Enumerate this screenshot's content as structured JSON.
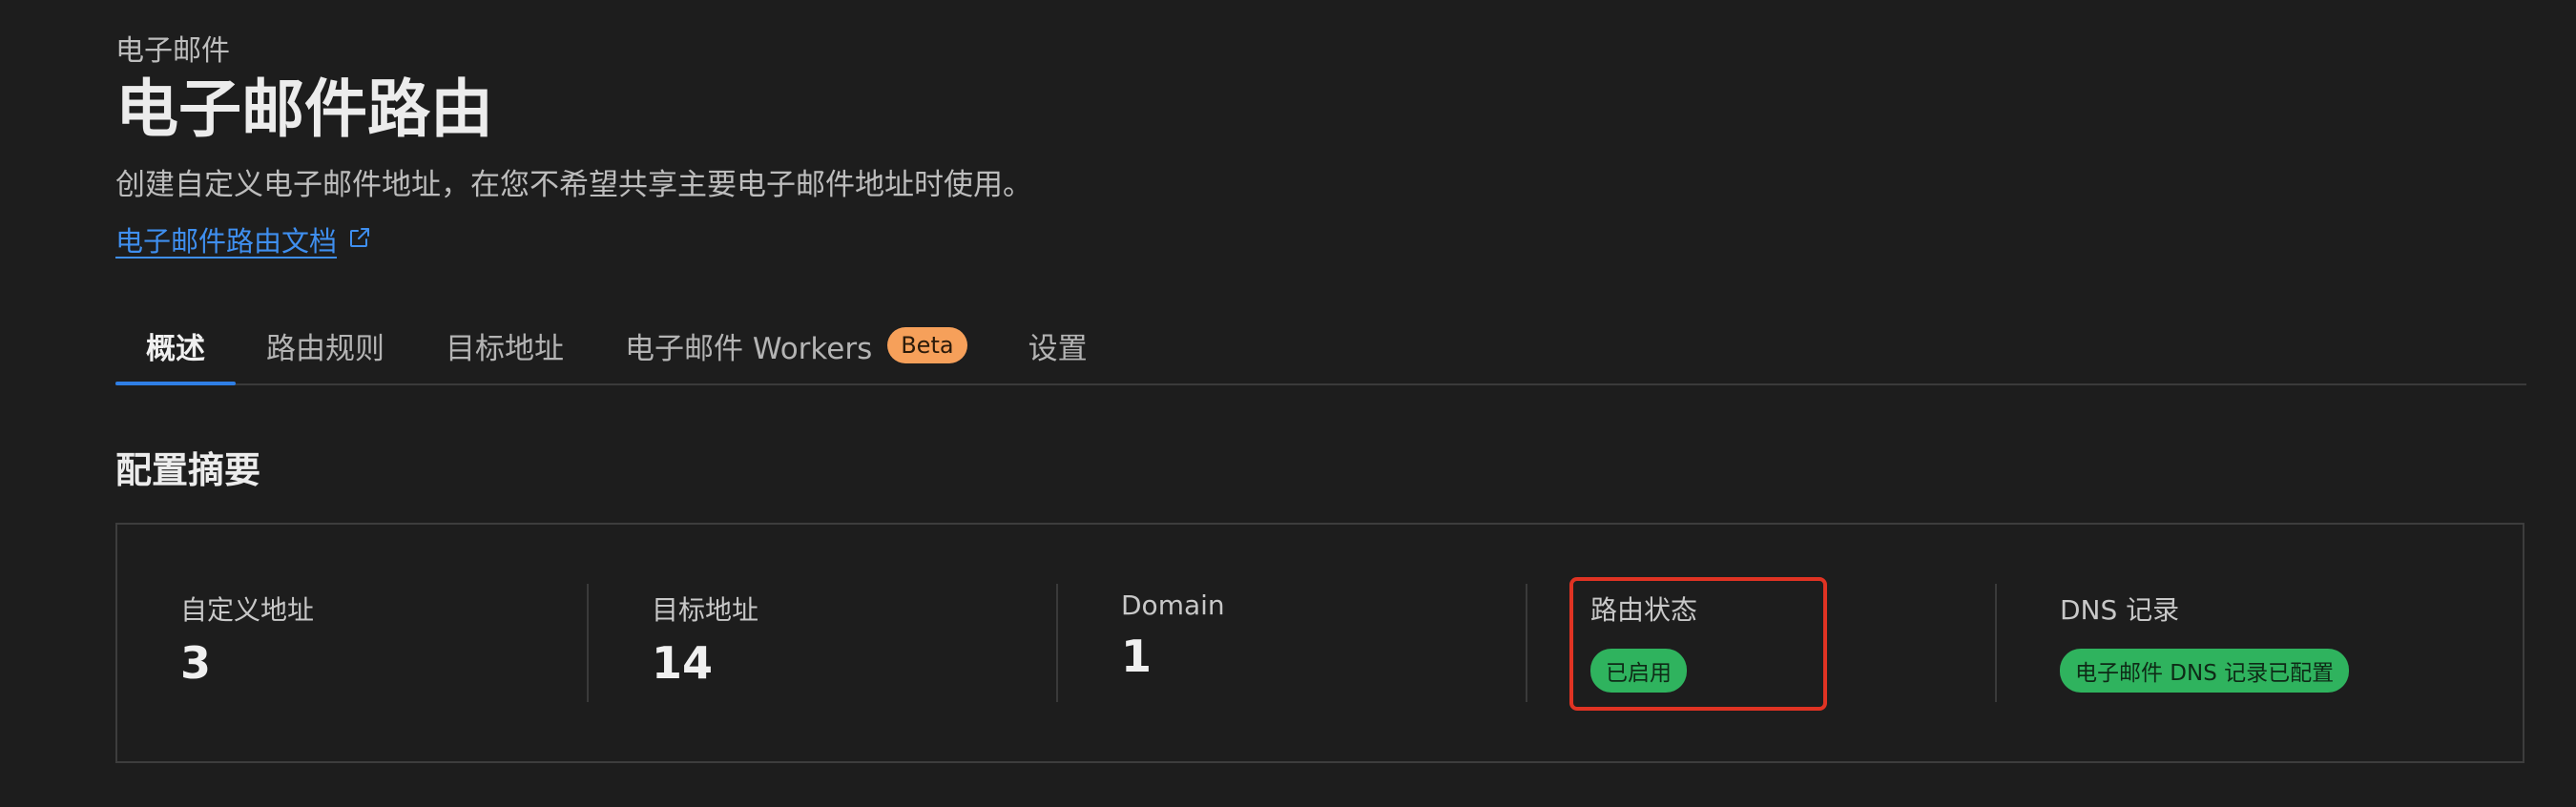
{
  "header": {
    "eyebrow": "电子邮件",
    "title": "电子邮件路由",
    "subtitle": "创建自定义电子邮件地址，在您不希望共享主要电子邮件地址时使用。",
    "doc_link": "电子邮件路由文档",
    "external_icon": "external-link-icon"
  },
  "tabs": [
    {
      "label": "概述",
      "active": true
    },
    {
      "label": "路由规则",
      "active": false
    },
    {
      "label": "目标地址",
      "active": false
    },
    {
      "label": "电子邮件 Workers",
      "active": false,
      "badge": "Beta"
    },
    {
      "label": "设置",
      "active": false
    }
  ],
  "summary": {
    "title": "配置摘要",
    "stats": [
      {
        "label": "自定义地址",
        "value": "3"
      },
      {
        "label": "目标地址",
        "value": "14"
      },
      {
        "label": "Domain",
        "value": "1"
      },
      {
        "label": "路由状态",
        "status": "已启用"
      },
      {
        "label": "DNS 记录",
        "status": "电子邮件 DNS 记录已配置"
      }
    ]
  },
  "colors": {
    "background": "#1d1d1d",
    "accent": "#2f7fe6",
    "link": "#3f8ff0",
    "beta_badge": "#f6a05a",
    "status_green": "#2fb35e",
    "highlight": "#e03323"
  }
}
